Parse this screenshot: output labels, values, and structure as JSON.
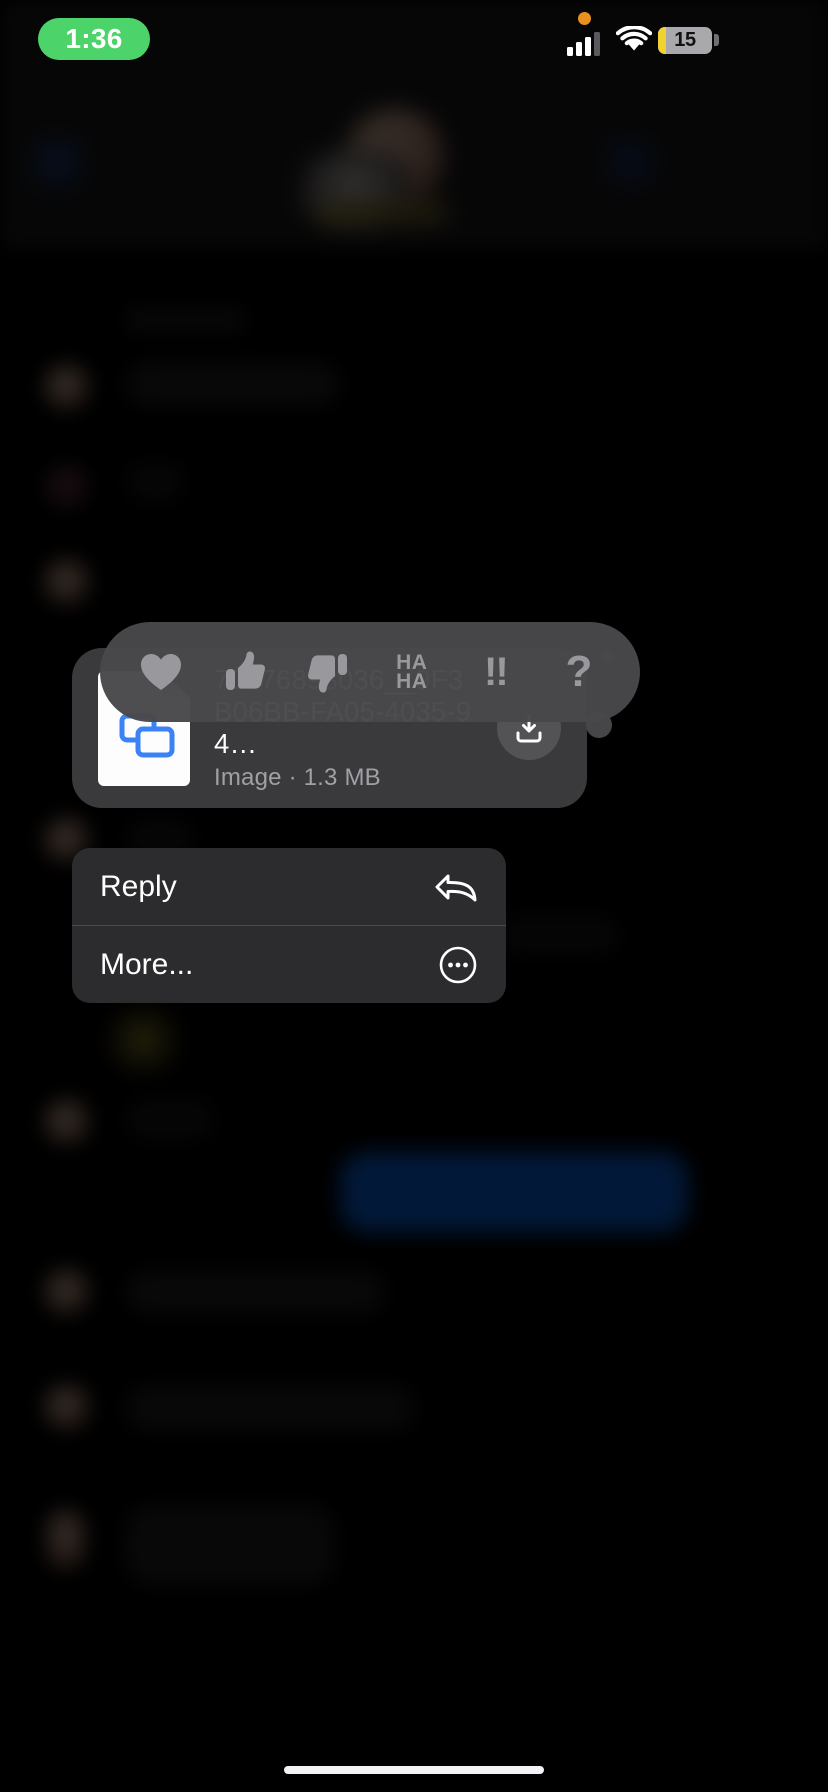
{
  "status_bar": {
    "time": "1:36",
    "time_pill_color": "#4cd369",
    "mic_indicator": "orange-dot",
    "signal_icon": "cellular-signal-icon",
    "wifi_icon": "wifi-icon",
    "battery_percent": "15",
    "battery_fill_color": "#f2d230"
  },
  "reaction_bar": {
    "items": [
      {
        "name": "heart",
        "glyph": "♥",
        "label": "Love"
      },
      {
        "name": "thumbs-up",
        "glyph": "👍",
        "label": "Like"
      },
      {
        "name": "thumbs-down",
        "glyph": "👎",
        "label": "Dislike"
      },
      {
        "name": "haha",
        "line1": "HA",
        "line2": "HA",
        "label": "Haha"
      },
      {
        "name": "exclamation",
        "glyph": "!!",
        "label": "Emphasize"
      },
      {
        "name": "question",
        "glyph": "?",
        "label": "Question"
      }
    ]
  },
  "attachment": {
    "file_name": "70376898036__9F3B06BB-FA05-4035-94…",
    "file_type_label": "Image",
    "file_size": "1.3 MB",
    "meta": "Image · 1.3 MB",
    "icon": "image-file-icon",
    "icon_accent": "#3b82f6",
    "action_icon": "download-icon"
  },
  "context_menu": {
    "items": [
      {
        "label": "Reply",
        "icon": "reply-arrow-icon"
      },
      {
        "label": "More...",
        "icon": "ellipsis-circle-icon"
      }
    ]
  },
  "home_indicator": {
    "present": true
  }
}
